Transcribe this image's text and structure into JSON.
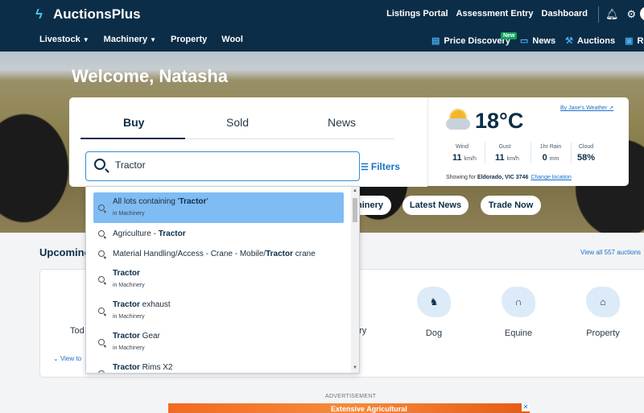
{
  "brand": {
    "name": "AuctionsPlus"
  },
  "topnav": {
    "links": [
      "Listings Portal",
      "Assessment Entry",
      "Dashboard"
    ]
  },
  "mainnav": {
    "items": [
      {
        "label": "Livestock",
        "dropdown": true
      },
      {
        "label": "Machinery",
        "dropdown": true
      },
      {
        "label": "Property",
        "dropdown": false
      },
      {
        "label": "Wool",
        "dropdown": false
      }
    ],
    "right": [
      {
        "label": "Price Discovery",
        "icon": "price-chart-icon",
        "badge": "New"
      },
      {
        "label": "News",
        "icon": "news-icon"
      },
      {
        "label": "Auctions",
        "icon": "gavel-icon"
      },
      {
        "label": "Res",
        "icon": "resources-icon"
      }
    ]
  },
  "hero": {
    "title": "Welcome, Natasha"
  },
  "search_card": {
    "tabs": [
      {
        "label": "Buy",
        "active": true
      },
      {
        "label": "Sold",
        "active": false
      },
      {
        "label": "News",
        "active": false
      }
    ],
    "search_value": "Tractor",
    "filters_label": "Filters"
  },
  "dropdown": {
    "items": [
      {
        "pre": "All lots containing '",
        "bold": "Tractor",
        "post": "'",
        "sub": "in Machinery",
        "highlight": true
      },
      {
        "pre": "Agriculture - ",
        "bold": "Tractor",
        "post": "",
        "sub": ""
      },
      {
        "pre": "Material Handling/Access - Crane - Mobile/",
        "bold": "Tractor",
        "post": " crane",
        "sub": ""
      },
      {
        "pre": "",
        "bold": "Tractor",
        "post": "",
        "sub": "in Machinery"
      },
      {
        "pre": "",
        "bold": "Tractor",
        "post": " exhaust",
        "sub": "in Machinery"
      },
      {
        "pre": "",
        "bold": "Tractor",
        "post": " Gear",
        "sub": "in Machinery"
      },
      {
        "pre": "",
        "bold": "Tractor",
        "post": " Rims X2",
        "sub": ""
      }
    ]
  },
  "weather": {
    "source_link": "By Jane's Weather",
    "temperature": "18°C",
    "columns": [
      {
        "label": "Wind",
        "value": "11",
        "unit": "km/h"
      },
      {
        "label": "Gust",
        "value": "11",
        "unit": "km/h"
      },
      {
        "label": "1hr Rain",
        "value": "0",
        "unit": "mm"
      },
      {
        "label": "Cloud",
        "value": "58%",
        "unit": ""
      }
    ],
    "showing_for_prefix": "Showing for ",
    "location": "Eldorado, VIC 3746",
    "change_location": "Change location"
  },
  "pills": {
    "partial_machinery": "hinery",
    "latest_news": "Latest News",
    "trade_now": "Trade Now"
  },
  "upcoming": {
    "title_partial": "Upcoming",
    "view_all": "View all 557 auctions",
    "today_partial": "Tod",
    "view_today_partial": "View to",
    "ery_partial": "ery",
    "categories": [
      {
        "label": "Dog",
        "icon": "dog-icon"
      },
      {
        "label": "Equine",
        "icon": "horse-icon"
      },
      {
        "label": "Property",
        "icon": "property-icon"
      }
    ]
  },
  "advertisement": {
    "label": "ADVERTISEMENT",
    "text": "Extensive Agricultural"
  }
}
